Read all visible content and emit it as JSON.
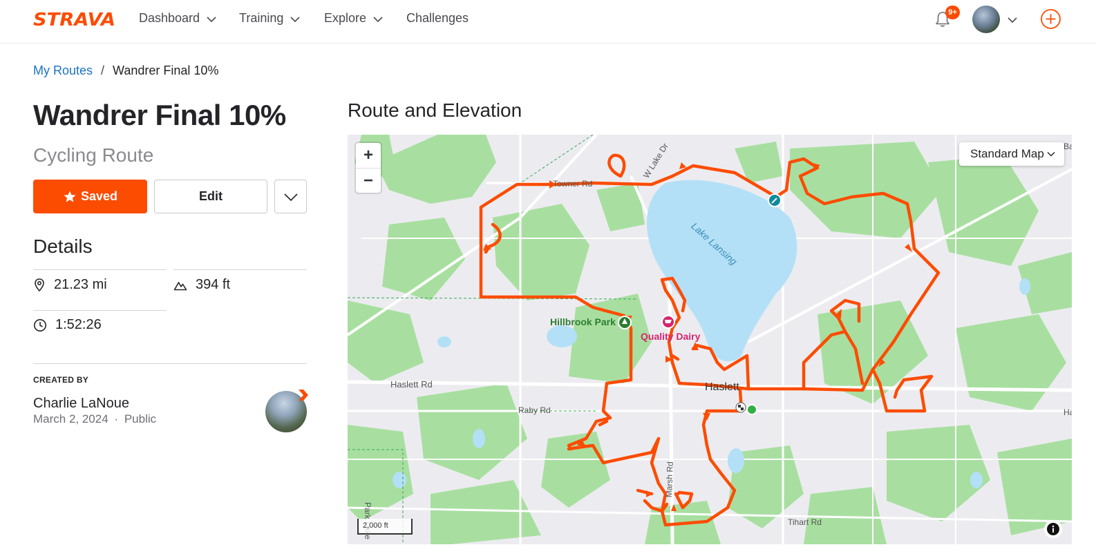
{
  "nav": {
    "logo": "STRAVA",
    "items": [
      {
        "label": "Dashboard"
      },
      {
        "label": "Training"
      },
      {
        "label": "Explore"
      },
      {
        "label": "Challenges"
      }
    ],
    "notification_count": "9+"
  },
  "breadcrumb": {
    "parent": "My Routes",
    "separator": "/",
    "current": "Wandrer Final 10%"
  },
  "route": {
    "title": "Wandrer Final 10%",
    "type": "Cycling Route"
  },
  "actions": {
    "saved_label": "Saved",
    "edit_label": "Edit"
  },
  "details": {
    "heading": "Details",
    "distance": "21.23 mi",
    "elevation": "394 ft",
    "time": "1:52:26"
  },
  "creator": {
    "label": "CREATED BY",
    "name": "Charlie LaNoue",
    "date": "March 2, 2024",
    "dot": "·",
    "visibility": "Public"
  },
  "map": {
    "heading": "Route and Elevation",
    "style": "Standard Map",
    "scale": "2,000 ft",
    "labels": {
      "towner": "Towner Rd",
      "lake_dr": "W Lake Dr",
      "lake": "Lake Lansing",
      "hillbrook": "Hillbrook Park",
      "quality_dairy": "Quality Dairy",
      "haslett": "Haslett",
      "haslett_rd": "Haslett Rd",
      "raby": "Raby Rd",
      "marsh": "Marsh Rd",
      "tihart": "Tihart Rd",
      "park_lake": "Park Lake",
      "edge_ha": "Ha",
      "edge_ba": "Ba"
    },
    "colors": {
      "route": "#fc4c02",
      "water": "#b3e0f7",
      "park": "#a8dfa0",
      "land": "#ececf0",
      "road": "#ffffff"
    }
  },
  "colors": {
    "accent": "#fc4c02",
    "link": "#1a73c2"
  },
  "icons": {
    "notification": "bell-icon",
    "star": "star-icon",
    "distance": "location-pin-icon",
    "elevation": "mountain-icon",
    "time": "clock-icon",
    "create": "plus-circle-icon",
    "info": "info-icon"
  }
}
